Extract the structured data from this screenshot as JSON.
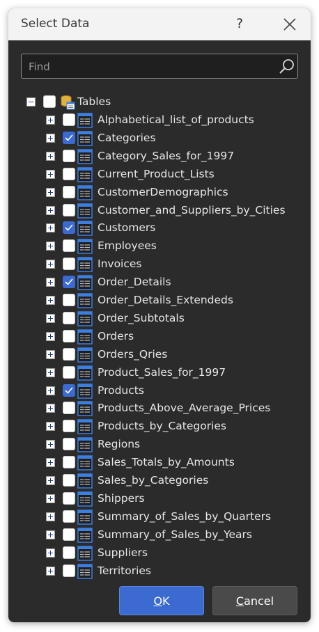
{
  "dialog": {
    "title": "Select Data",
    "help_label": "?",
    "search": {
      "placeholder": "Find",
      "value": ""
    },
    "tree": {
      "root": {
        "label": "Tables",
        "checked": false,
        "expanded": true
      },
      "items": [
        {
          "label": "Alphabetical_list_of_products",
          "checked": false
        },
        {
          "label": "Categories",
          "checked": true
        },
        {
          "label": "Category_Sales_for_1997",
          "checked": false
        },
        {
          "label": "Current_Product_Lists",
          "checked": false
        },
        {
          "label": "CustomerDemographics",
          "checked": false
        },
        {
          "label": "Customer_and_Suppliers_by_Cities",
          "checked": false
        },
        {
          "label": "Customers",
          "checked": true
        },
        {
          "label": "Employees",
          "checked": false
        },
        {
          "label": "Invoices",
          "checked": false
        },
        {
          "label": "Order_Details",
          "checked": true
        },
        {
          "label": "Order_Details_Extendeds",
          "checked": false
        },
        {
          "label": "Order_Subtotals",
          "checked": false
        },
        {
          "label": "Orders",
          "checked": false
        },
        {
          "label": "Orders_Qries",
          "checked": false
        },
        {
          "label": "Product_Sales_for_1997",
          "checked": false
        },
        {
          "label": "Products",
          "checked": true
        },
        {
          "label": "Products_Above_Average_Prices",
          "checked": false
        },
        {
          "label": "Products_by_Categories",
          "checked": false
        },
        {
          "label": "Regions",
          "checked": false
        },
        {
          "label": "Sales_Totals_by_Amounts",
          "checked": false
        },
        {
          "label": "Sales_by_Categories",
          "checked": false
        },
        {
          "label": "Shippers",
          "checked": false
        },
        {
          "label": "Summary_of_Sales_by_Quarters",
          "checked": false
        },
        {
          "label": "Summary_of_Sales_by_Years",
          "checked": false
        },
        {
          "label": "Suppliers",
          "checked": false
        },
        {
          "label": "Territories",
          "checked": false
        }
      ]
    },
    "buttons": {
      "ok": {
        "mnemonic": "O",
        "rest": "K"
      },
      "cancel": {
        "mnemonic": "C",
        "rest": "ancel"
      }
    },
    "colors": {
      "background": "#2b2b2b",
      "accent": "#3b6bd1",
      "text": "#e6e6e6"
    }
  }
}
